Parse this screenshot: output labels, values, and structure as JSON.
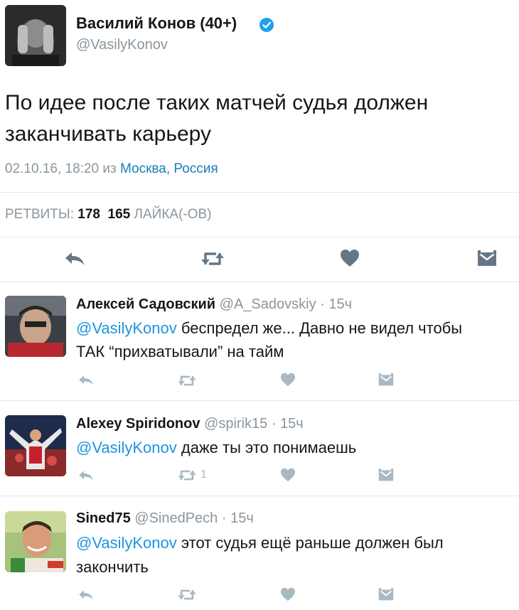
{
  "main_tweet": {
    "author_name": "Василий Конов (40+)",
    "author_handle": "@VasilyKonov",
    "text_line1": "По идее после таких матчей судья должен",
    "text_line2": "заканчивать карьеру",
    "date": "02.10.16, 18:20",
    "from_word": "из",
    "location": "Москва, Россия",
    "retweets_label": "РЕТВИТЫ:",
    "retweets_count": "178",
    "likes_count": "165",
    "likes_label": "ЛАЙКА(-ОВ)"
  },
  "replies": [
    {
      "name": "Алексей Садовский",
      "handle": "@A_Sadovskiy",
      "time": "15ч",
      "mention": "@VasilyKonov",
      "text_line1": "беспредел же... Давно не видел чтобы",
      "text_line2": "ТАК “прихватывали” на тайм",
      "retweet_count": ""
    },
    {
      "name": "Alexey Spiridonov",
      "handle": "@spirik15",
      "time": "15ч",
      "mention": "@VasilyKonov",
      "text_line1": "даже ты это понимаешь",
      "text_line2": "",
      "retweet_count": "1"
    },
    {
      "name": "Sined75",
      "handle": "@SinedPech",
      "time": "15ч",
      "mention": "@VasilyKonov",
      "text_line1": "этот судья ещё раньше должен был",
      "text_line2": "закончить",
      "retweet_count": ""
    }
  ],
  "colors": {
    "link": "#1b95e0",
    "muted": "#8a959e",
    "icon": "#657786",
    "divider": "#e1e8ed",
    "verified": "#1da1f2"
  },
  "icons": [
    "reply-icon",
    "retweet-icon",
    "like-icon",
    "message-icon",
    "verified-badge-icon"
  ]
}
